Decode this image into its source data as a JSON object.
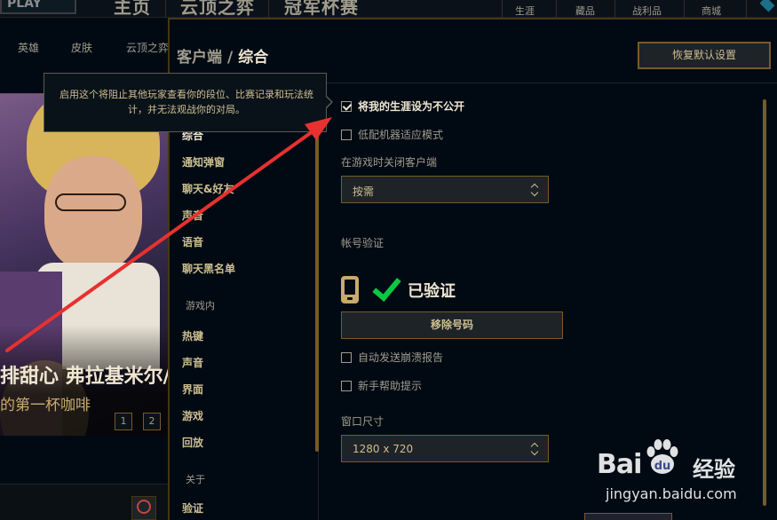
{
  "top_nav": {
    "logo_text": "PLAY",
    "main_tabs": [
      "主页",
      "云顶之弈",
      "冠军杯赛"
    ],
    "right_tabs": [
      "生涯",
      "藏品",
      "战利品",
      "商城"
    ]
  },
  "sub_nav": {
    "tabs": [
      "英雄",
      "皮肤",
      "云顶之弈"
    ]
  },
  "hero_banner": {
    "title": "排甜心 弗拉基米尔/",
    "subtitle": "的第一杯咖啡",
    "pages": [
      "1",
      "2"
    ]
  },
  "settings": {
    "breadcrumb_parent": "客户端",
    "breadcrumb_separator": "/",
    "breadcrumb_current": "综合",
    "reset_button": "恢复默认设置",
    "sidebar": {
      "client_items": [
        "综合",
        "通知弹窗",
        "聊天&好友",
        "声音",
        "语音",
        "聊天黑名单"
      ],
      "in_game_category": "游戏内",
      "in_game_items": [
        "热键",
        "声音",
        "界面",
        "游戏",
        "回放"
      ],
      "about_category": "关于",
      "about_items": [
        "验证"
      ]
    },
    "options": {
      "private_career_label": "将我的生涯设为不公开",
      "private_career_checked": true,
      "low_spec_label": "低配机器适应模式",
      "low_spec_checked": false,
      "close_client_label": "在游戏时关闭客户端",
      "close_client_value": "按需",
      "account_verify_label": "帐号验证",
      "verified_text": "已验证",
      "remove_number_button": "移除号码",
      "auto_crash_report_label": "自动发送崩溃报告",
      "auto_crash_report_checked": false,
      "newbie_tips_label": "新手帮助提示",
      "newbie_tips_checked": false,
      "window_size_label": "窗口尺寸",
      "window_size_value": "1280 x 720"
    },
    "tooltip_text": "启用这个将阻止其他玩家查看你的段位、比赛记录和玩法统计，并无法观战你的对局。"
  },
  "watermark": {
    "brand_latin": "Bai",
    "brand_cn": "经验",
    "url": "jingyan.baidu.com"
  },
  "colors": {
    "gold": "#c8aa6e",
    "gold_dark": "#785a28",
    "text_light": "#f0e6d2",
    "text_muted": "#a09b8c",
    "background": "#010a13",
    "check_green": "#0ac843",
    "annotation_red": "#e8312f"
  }
}
